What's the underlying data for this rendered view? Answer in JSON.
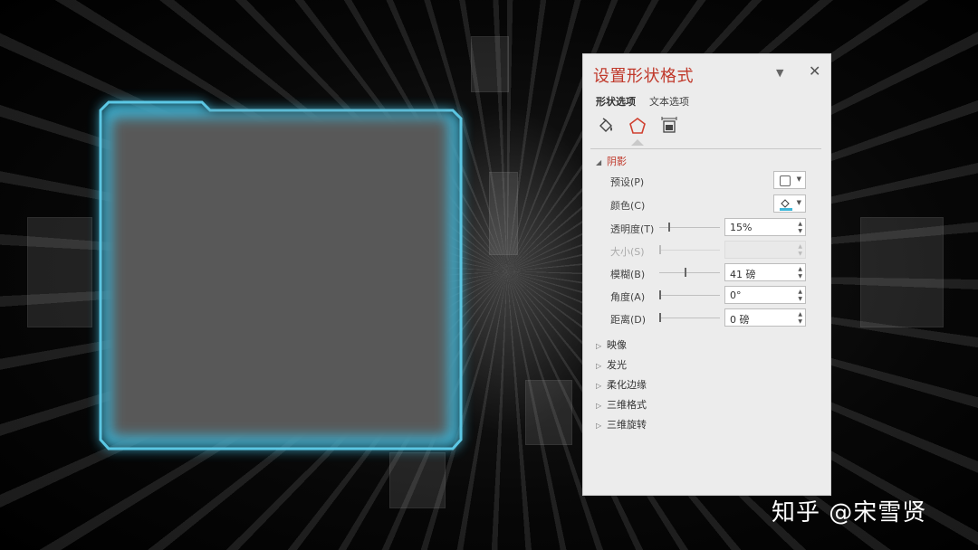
{
  "pane": {
    "title": "设置形状格式",
    "dropdown_icon": "chevron-down-icon",
    "close_icon": "close-icon",
    "tabs": [
      {
        "label": "形状选项",
        "active": true
      },
      {
        "label": "文本选项",
        "active": false
      }
    ],
    "icons": [
      "fill-line-icon",
      "effects-pentagon-icon",
      "size-properties-icon"
    ],
    "sections": {
      "shadow": {
        "label": "阴影",
        "expanded": true,
        "preset_label": "预设(P)",
        "color_label": "颜色(C)",
        "rows": [
          {
            "label": "透明度(T)",
            "value": "15%",
            "level": 0.15,
            "enabled": true
          },
          {
            "label": "大小(S)",
            "value": "",
            "level": 0,
            "enabled": false
          },
          {
            "label": "模糊(B)",
            "value": "41 磅",
            "level": 0.41,
            "enabled": true
          },
          {
            "label": "角度(A)",
            "value": "0°",
            "level": 0,
            "enabled": true
          },
          {
            "label": "距离(D)",
            "value": "0 磅",
            "level": 0,
            "enabled": true
          }
        ]
      },
      "collapsed": [
        "映像",
        "发光",
        "柔化边缘",
        "三维格式",
        "三维旋转"
      ]
    }
  },
  "colors": {
    "accent_red": "#c0392b",
    "shape_fill": "#595959",
    "shape_glow": "#3fb7d9"
  },
  "watermark": "知乎 @宋雪贤"
}
